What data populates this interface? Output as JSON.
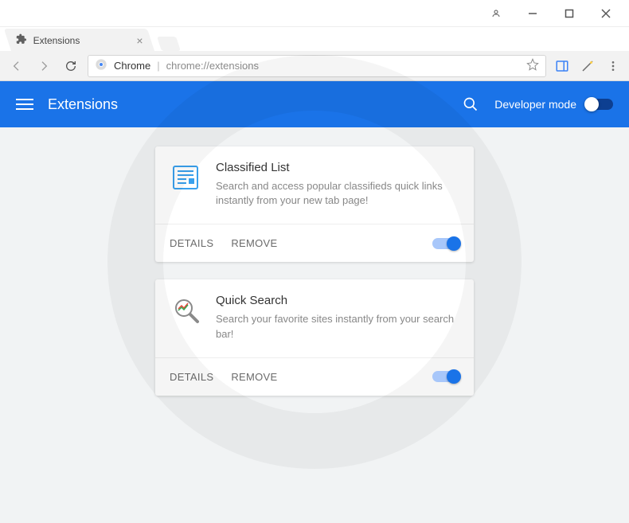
{
  "window": {
    "tab_title": "Extensions"
  },
  "toolbar": {
    "origin_label": "Chrome",
    "url_text": "chrome://extensions"
  },
  "header": {
    "title": "Extensions",
    "developer_mode_label": "Developer mode"
  },
  "actions": {
    "details": "DETAILS",
    "remove": "REMOVE"
  },
  "extensions": [
    {
      "name": "Classified List",
      "description": "Search and access popular classifieds quick links instantly from your new tab page!",
      "enabled": true,
      "icon": "newspaper"
    },
    {
      "name": "Quick Search",
      "description": "Search your favorite sites instantly from your search bar!",
      "enabled": true,
      "icon": "magnifier"
    }
  ]
}
